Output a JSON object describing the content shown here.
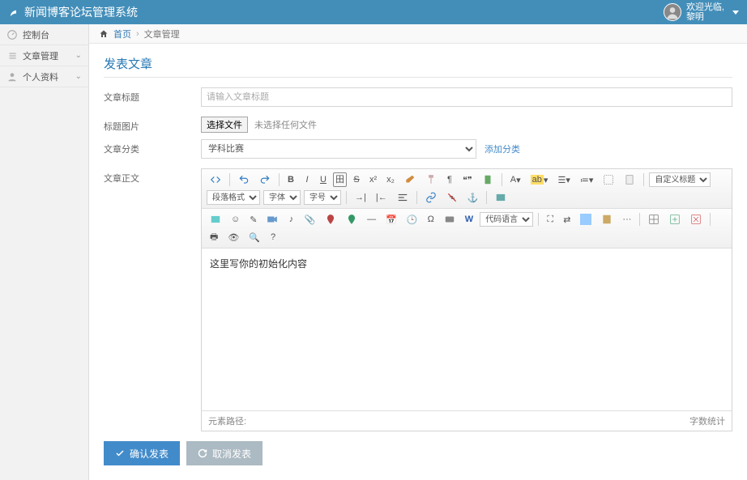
{
  "topbar": {
    "brand": "新闻博客论坛管理系统",
    "welcome_prefix": "欢迎光临,",
    "username": "黎明"
  },
  "sidebar": {
    "items": [
      {
        "label": "控制台",
        "icon": "dashboard-icon",
        "has_children": false
      },
      {
        "label": "文章管理",
        "icon": "list-icon",
        "has_children": true
      },
      {
        "label": "个人资料",
        "icon": "user-icon",
        "has_children": true
      }
    ]
  },
  "breadcrumb": {
    "home": "首页",
    "current": "文章管理"
  },
  "page": {
    "title": "发表文章"
  },
  "form": {
    "title_label": "文章标题",
    "title_placeholder": "请输入文章标题",
    "image_label": "标题图片",
    "file_button": "选择文件",
    "file_hint": "未选择任何文件",
    "category_label": "文章分类",
    "category_selected": "学科比赛",
    "add_category_link": "添加分类",
    "body_label": "文章正文",
    "editor_content": "这里写你的初始化内容",
    "editor_path": "元素路径:",
    "editor_wordcount": "字数统计",
    "toolbar_selects": {
      "custom_title": "自定义标题",
      "paragraph_format": "段落格式",
      "font_family": "字体",
      "font_size": "字号",
      "code_language": "代码语言"
    }
  },
  "buttons": {
    "submit": "确认发表",
    "cancel": "取消发表"
  }
}
